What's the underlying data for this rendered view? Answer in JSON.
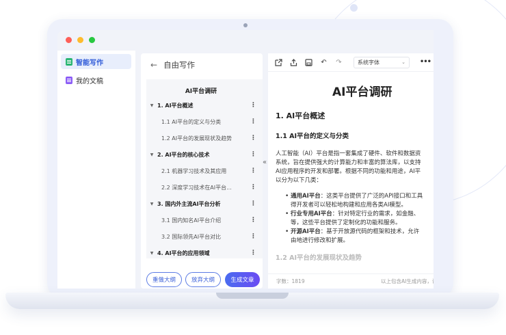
{
  "colors": {
    "accent": "#2f5bd8",
    "red": "#fe5f57",
    "yellow": "#febc2e",
    "green": "#28c840",
    "nav_icon_green": "#2bb673",
    "nav_icon_purple": "#8b5cf6"
  },
  "nav": {
    "items": [
      {
        "label": "智能写作",
        "icon": "smart-write-icon"
      },
      {
        "label": "我的文稿",
        "icon": "document-icon"
      }
    ]
  },
  "outline": {
    "back_label": "自由写作",
    "title": "AI平台调研",
    "rows": [
      {
        "text": "1. AI平台概述",
        "level": 1
      },
      {
        "text": "1.1 AI平台的定义与分类",
        "level": 2
      },
      {
        "text": "1.2 AI平台的发展现状及趋势",
        "level": 2
      },
      {
        "text": "2. AI平台的核心技术",
        "level": 1
      },
      {
        "text": "2.1 机器学习技术及其应用",
        "level": 2
      },
      {
        "text": "2.2 深度学习技术在AI平台...",
        "level": 2
      },
      {
        "text": "3. 国内外主流AI平台分析",
        "level": 1
      },
      {
        "text": "3.1 国内知名AI平台介绍",
        "level": 2
      },
      {
        "text": "3.2 国际领先AI平台对比",
        "level": 2
      },
      {
        "text": "4. AI平台的应用领域",
        "level": 1
      }
    ],
    "buttons": {
      "redo": "重做大纲",
      "discard": "放弃大纲",
      "generate": "生成文章"
    }
  },
  "editor": {
    "font_select": "系统字体",
    "doc": {
      "title": "AI平台调研",
      "h1": "1. AI平台概述",
      "h2": "1.1 AI平台的定义与分类",
      "paragraph": [
        "人工智能（AI）平台是指一套集成了硬件、软件和数据资",
        "系统，旨在提供强大的计算能力和丰富的算法库，以支持",
        "AI应用程序的开发和部署。根据不同的功能和用途，AI平",
        "以分为以下几类："
      ],
      "list": [
        {
          "bold": "通用AI平台",
          "lines": [
            "：这类平台提供了广泛的API接口和工具",
            "得开发者可以轻松地构建和应用各类AI模型。"
          ]
        },
        {
          "bold": "行业专用AI平台",
          "lines": [
            "：针对特定行业的需求，如金融、",
            "等，这些平台提供了定制化的功能和服务。"
          ]
        },
        {
          "bold": "开源AI平台",
          "lines": [
            "：基于开放源代码的框架和技术，允许",
            "由地进行修改和扩展。"
          ]
        }
      ],
      "faded": "1.2 AI平台的发展现状及趋势"
    },
    "word_count": "字数：1819",
    "footer_note": "以上包含AI生成内容，请"
  }
}
